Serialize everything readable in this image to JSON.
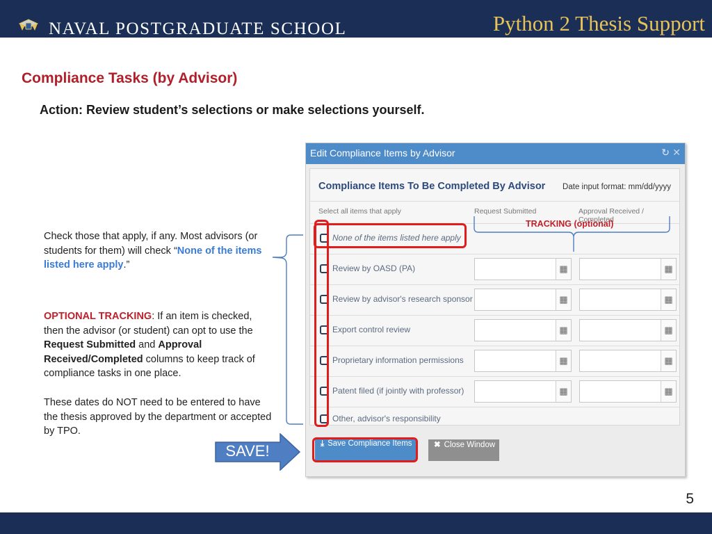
{
  "header": {
    "org_name": "NAVAL POSTGRADUATE SCHOOL",
    "deck_title": "Python 2 Thesis Support"
  },
  "slide": {
    "section_title": "Compliance Tasks (by Advisor)",
    "action": "Action: Review student’s selections or make selections yourself.",
    "page_number": "5",
    "save_arrow_label": "SAVE!",
    "tracking_label": "TRACKING (optional)"
  },
  "notes": {
    "check_prefix": "Check those that apply, if any. Most advisors (or students for them) will check “",
    "check_highlight": "None of the items listed here apply",
    "check_suffix": ".”",
    "tracking_term": "OPTIONAL TRACKING",
    "tracking_mid1": ": If an item is checked, then the advisor (or student) can opt to use the ",
    "tracking_col1": "Request Submitted",
    "tracking_and": " and ",
    "tracking_col2": "Approval Received/Completed",
    "tracking_end": " columns to keep track of compliance tasks in one place.",
    "dates_note": "These dates do NOT need to be entered to have the thesis approved by the department or accepted by TPO."
  },
  "dialog": {
    "title": "Edit Compliance Items by Advisor",
    "refresh_icon": "↻",
    "close_icon": "✕",
    "heading": "Compliance Items To Be Completed By Advisor",
    "date_format": "Date input format: mm/dd/yyyy",
    "columns": {
      "select_all": "Select all items that apply",
      "request_submitted": "Request Submitted",
      "approval": "Approval Received / Completed"
    },
    "items": [
      {
        "label": "None of the items listed here apply"
      },
      {
        "label": "Review by OASD (PA)"
      },
      {
        "label": "Review by advisor's research sponsor"
      },
      {
        "label": "Export control review"
      },
      {
        "label": "Proprietary information permissions"
      },
      {
        "label": "Patent filed (if jointly with professor)"
      },
      {
        "label": "Other, advisor's responsibility"
      }
    ],
    "calendar_icon": "▦",
    "save_button": "Save Compliance Items",
    "close_button": "Close Window",
    "save_icon": "⤓",
    "close_btn_icon": "✖"
  },
  "colors": {
    "header_navy": "#1b2e55",
    "deck_title_gold": "#e6c35a",
    "section_red": "#b0202a",
    "dialog_blue": "#4d8bc9",
    "highlight_red": "#e21b1b",
    "note_blue": "#3a7bd5"
  }
}
